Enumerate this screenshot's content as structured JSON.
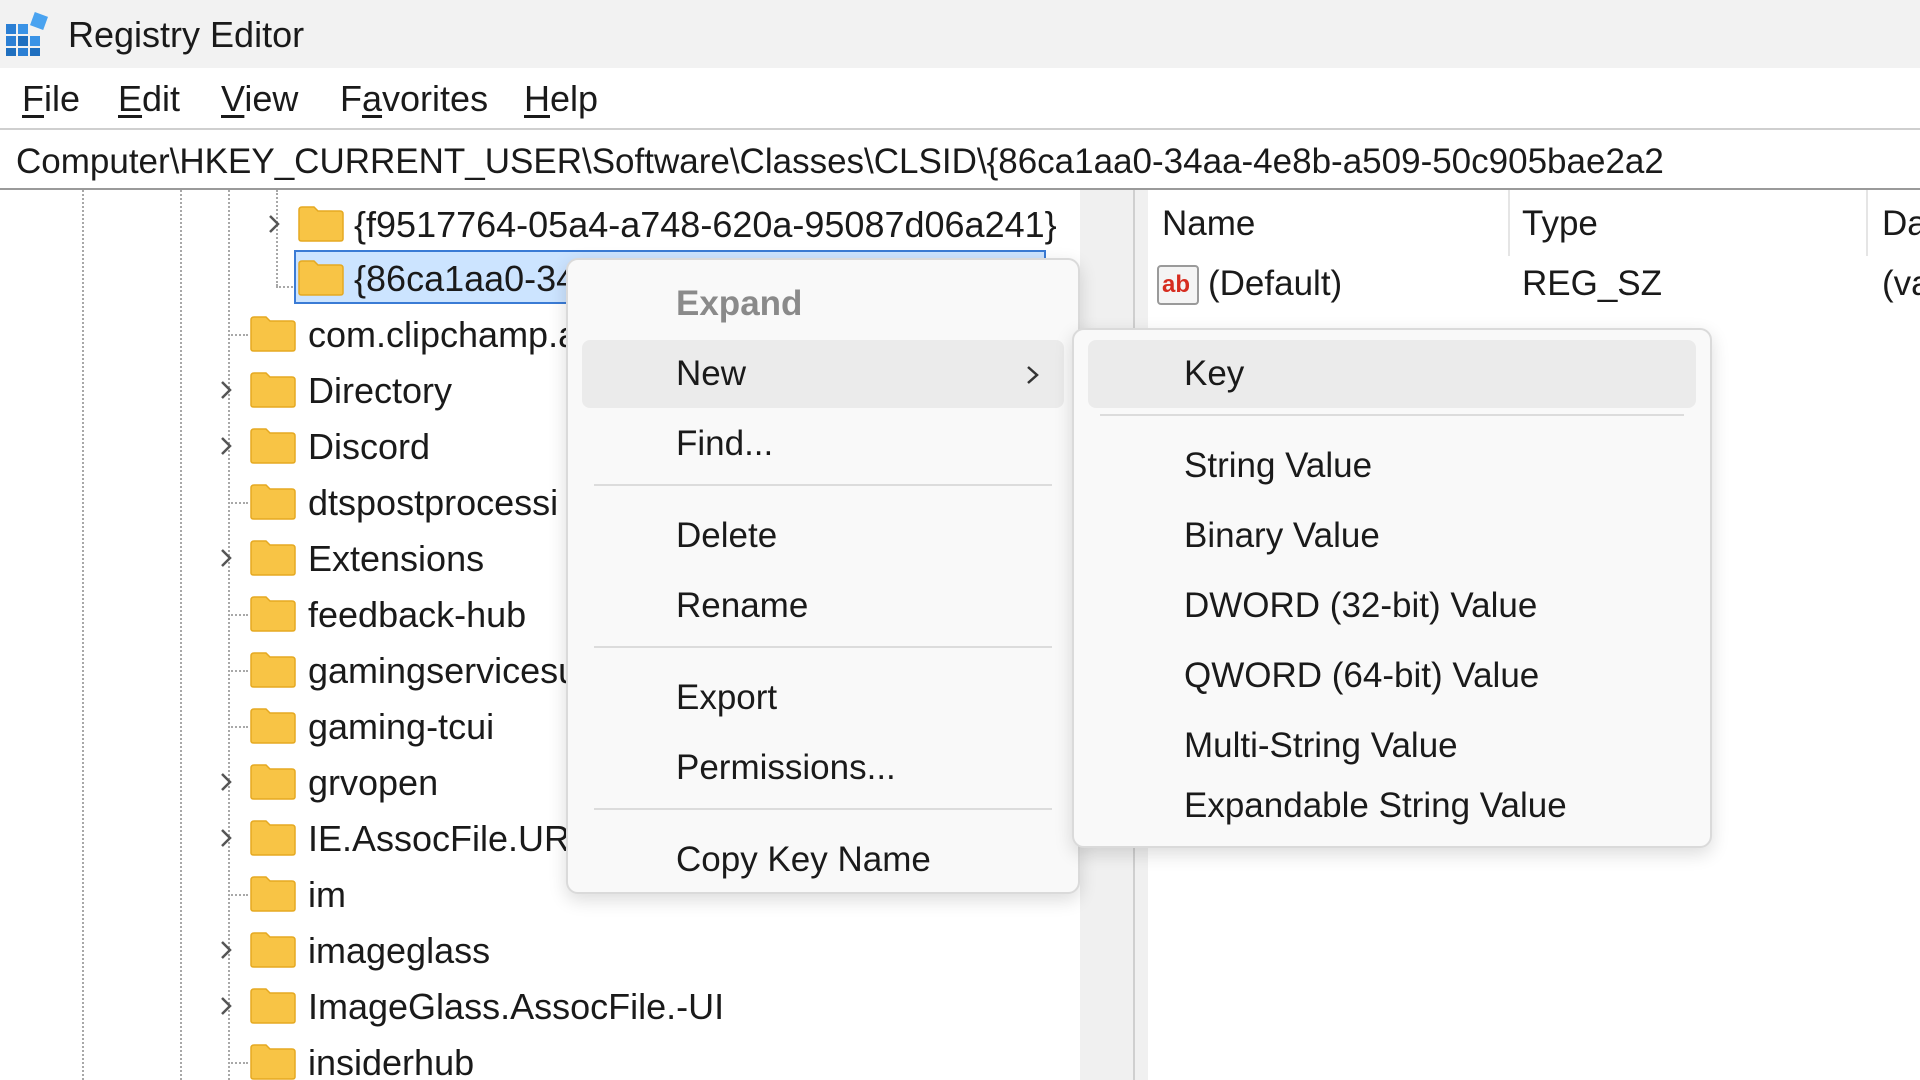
{
  "window": {
    "title": "Registry Editor",
    "app_icon": "registry-editor-icon"
  },
  "menubar": {
    "items": [
      {
        "pre": "",
        "u": "F",
        "post": "ile"
      },
      {
        "pre": "",
        "u": "E",
        "post": "dit"
      },
      {
        "pre": "",
        "u": "V",
        "post": "iew"
      },
      {
        "pre": "F",
        "u": "a",
        "post": "vorites"
      },
      {
        "pre": "",
        "u": "H",
        "post": "elp"
      }
    ]
  },
  "address": {
    "path": "Computer\\HKEY_CURRENT_USER\\Software\\Classes\\CLSID\\{86ca1aa0-34aa-4e8b-a509-50c905bae2a2"
  },
  "tree": {
    "nodes": [
      {
        "label": "{f9517764-05a4-a748-620a-95087d06a241}",
        "expandable": true,
        "selected": false
      },
      {
        "label": "{86ca1aa0-34",
        "expandable": false,
        "selected": true
      },
      {
        "label": "com.clipchamp.a",
        "expandable": false,
        "selected": false
      },
      {
        "label": "Directory",
        "expandable": true,
        "selected": false
      },
      {
        "label": "Discord",
        "expandable": true,
        "selected": false
      },
      {
        "label": "dtspostprocessi",
        "expandable": false,
        "selected": false
      },
      {
        "label": "Extensions",
        "expandable": true,
        "selected": false
      },
      {
        "label": "feedback-hub",
        "expandable": false,
        "selected": false
      },
      {
        "label": "gamingservicesu",
        "expandable": false,
        "selected": false
      },
      {
        "label": "gaming-tcui",
        "expandable": false,
        "selected": false
      },
      {
        "label": "grvopen",
        "expandable": true,
        "selected": false
      },
      {
        "label": "IE.AssocFile.URL",
        "expandable": true,
        "selected": false
      },
      {
        "label": "im",
        "expandable": false,
        "selected": false
      },
      {
        "label": "imageglass",
        "expandable": true,
        "selected": false
      },
      {
        "label": "ImageGlass.AssocFile.-UI",
        "expandable": true,
        "selected": false
      },
      {
        "label": "insiderhub",
        "expandable": false,
        "selected": false
      }
    ]
  },
  "values": {
    "columns": {
      "name": "Name",
      "type": "Type",
      "data": "Da"
    },
    "rows": [
      {
        "icon": "string-value-ab-icon",
        "name": "(Default)",
        "type": "REG_SZ",
        "data": "(va"
      }
    ]
  },
  "context_menu": {
    "items": [
      {
        "label": "Expand",
        "disabled": true
      },
      {
        "label": "New",
        "submenu": true,
        "highlighted": true
      },
      {
        "label": "Find..."
      },
      {
        "label": "Delete"
      },
      {
        "label": "Rename"
      },
      {
        "label": "Export"
      },
      {
        "label": "Permissions..."
      },
      {
        "label": "Copy Key Name"
      }
    ]
  },
  "new_submenu": {
    "items": [
      {
        "label": "Key",
        "highlighted": true
      },
      {
        "label": "String Value"
      },
      {
        "label": "Binary Value"
      },
      {
        "label": "DWORD (32-bit) Value"
      },
      {
        "label": "QWORD (64-bit) Value"
      },
      {
        "label": "Multi-String Value"
      },
      {
        "label": "Expandable String Value"
      }
    ]
  },
  "colors": {
    "folder": "#f8c445",
    "folder_dark": "#e5a922",
    "selection_border": "#3a7bd5",
    "selection_fill": "#cce4ff",
    "menu_hover": "#ebebeb"
  }
}
